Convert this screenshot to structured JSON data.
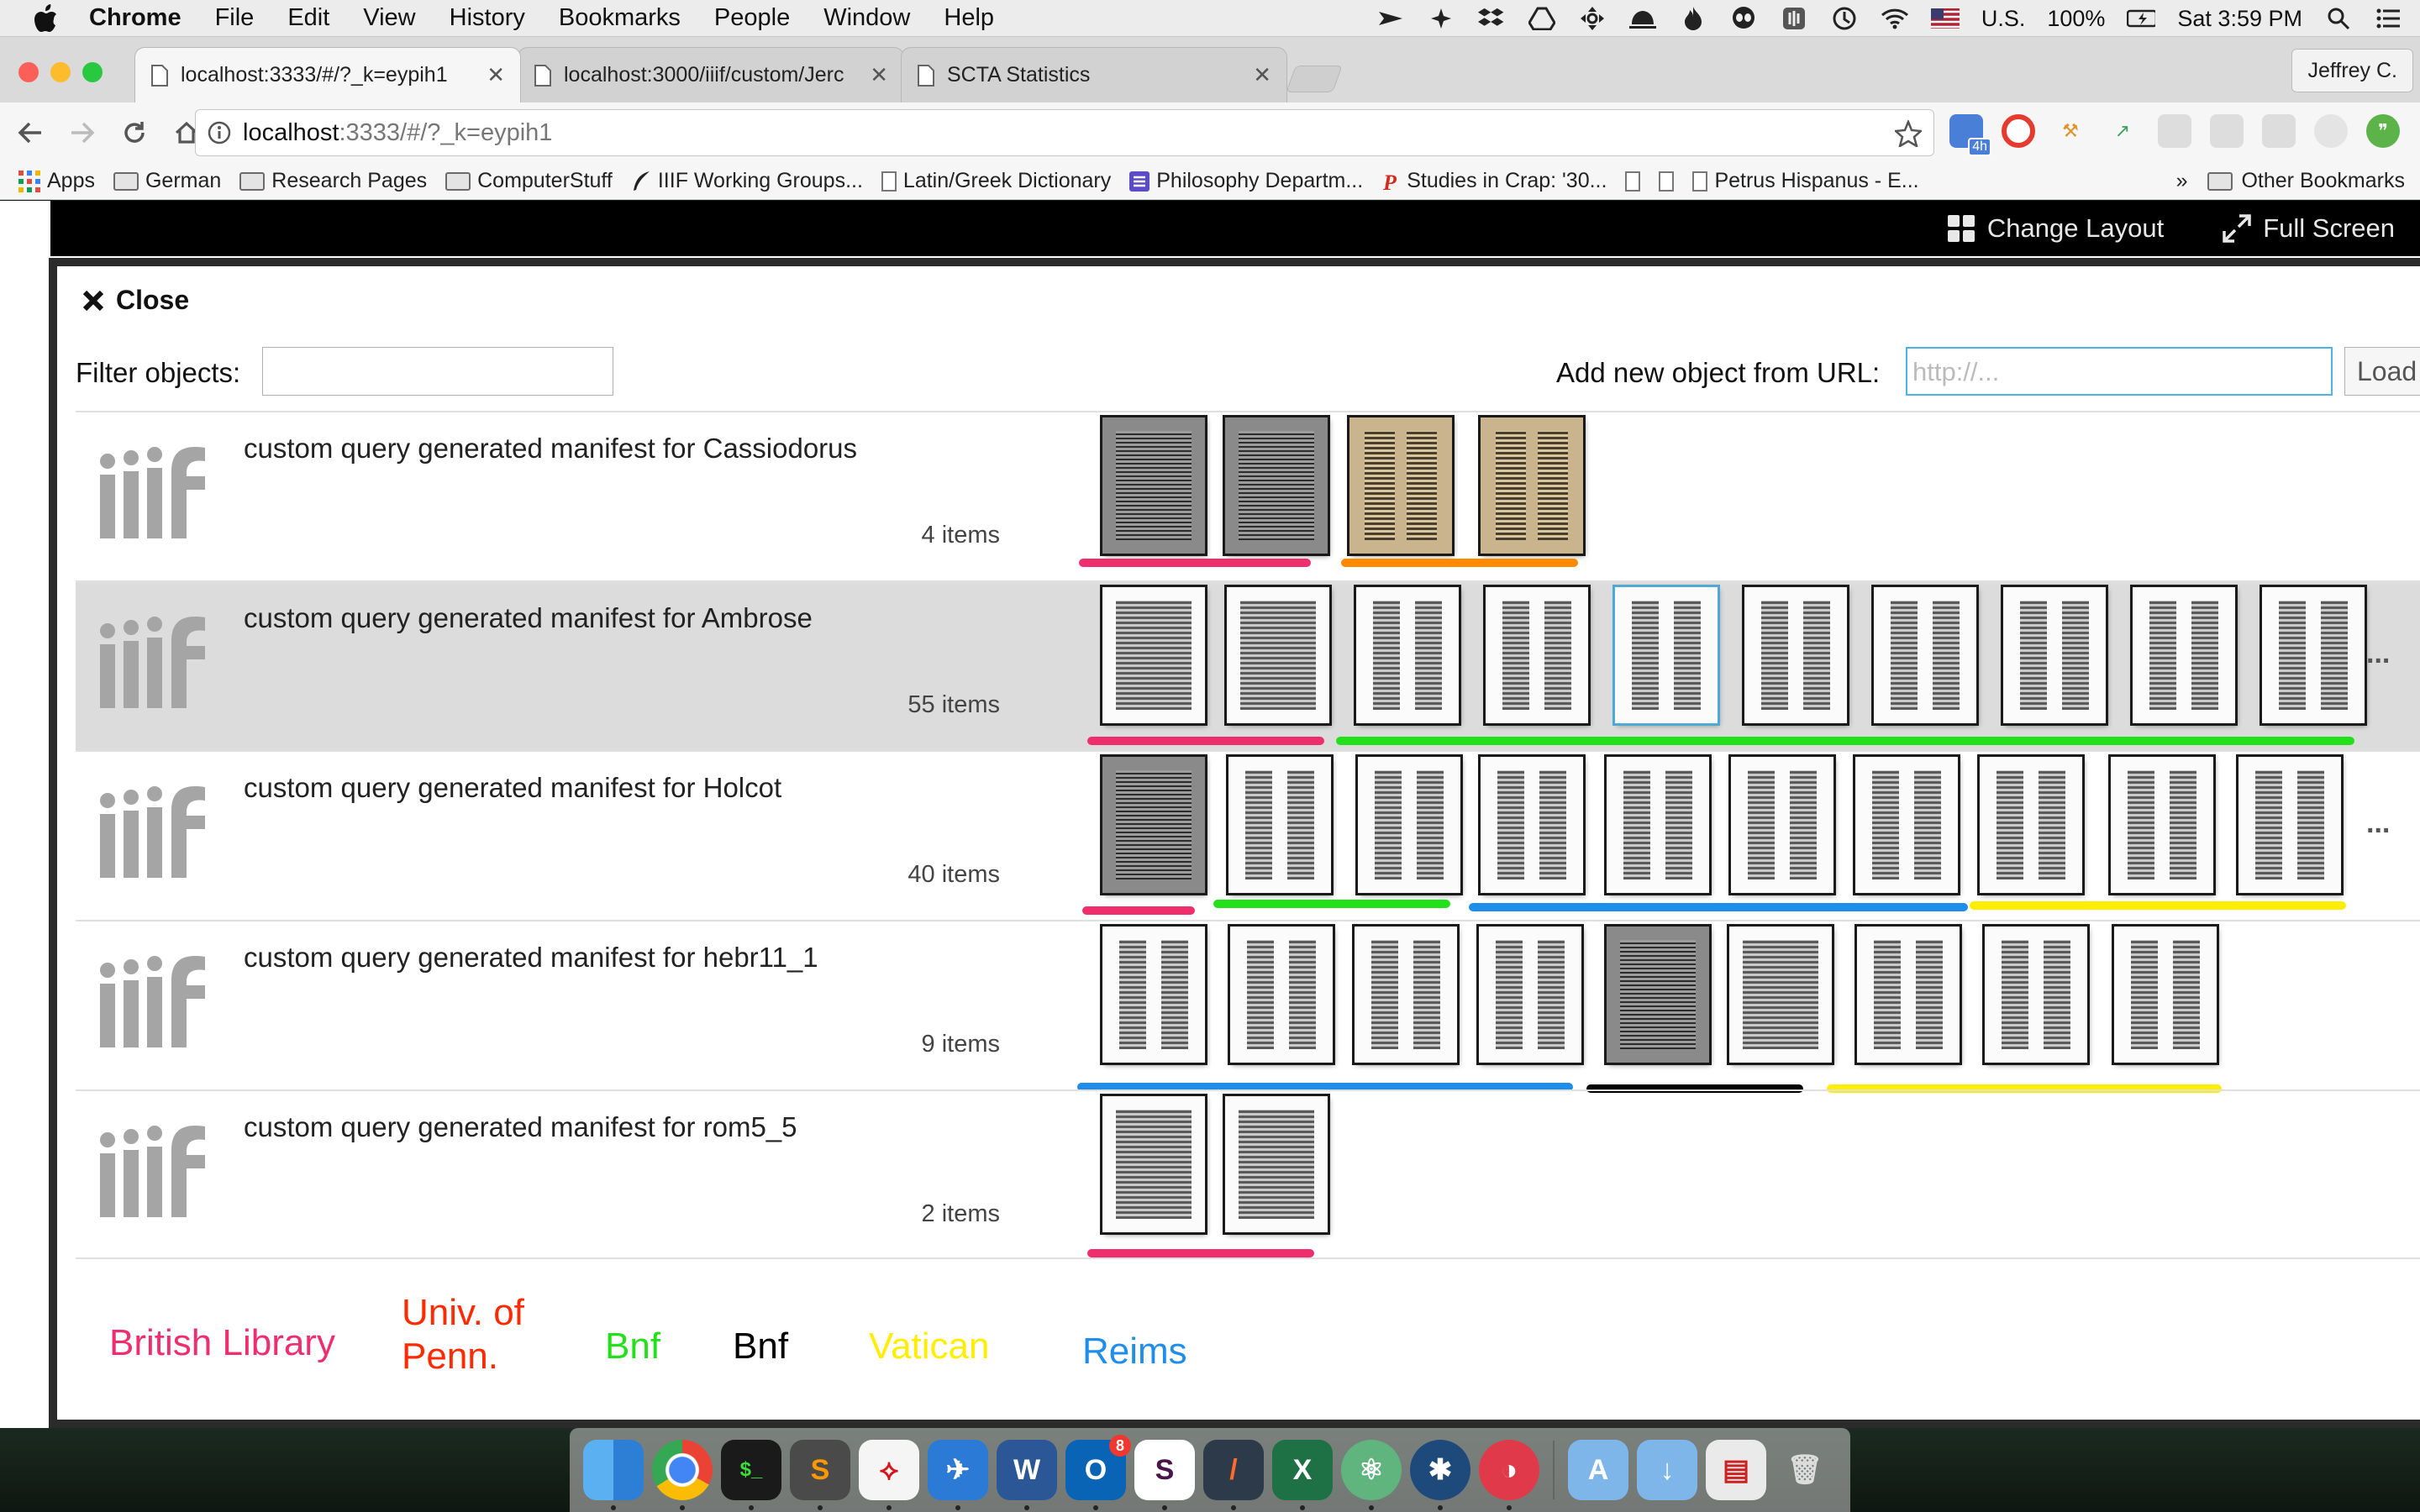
{
  "menubar": {
    "app": "Chrome",
    "items": [
      "File",
      "Edit",
      "View",
      "History",
      "Bookmarks",
      "People",
      "Window",
      "Help"
    ],
    "locale": "U.S.",
    "battery": "100%",
    "clock": "Sat 3:59 PM"
  },
  "tabs": [
    {
      "title": "localhost:3333/#/?_k=eypih1",
      "active": true
    },
    {
      "title": "localhost:3000/iiif/custom/Jerc",
      "active": false
    },
    {
      "title": "SCTA Statistics",
      "active": false
    }
  ],
  "profile": "Jeffrey C.",
  "address": {
    "host": "localhost",
    "path": ":3333/#/?_k=eypih1"
  },
  "extension_badge": "4h",
  "bookmarks": [
    "Apps",
    "German",
    "Research Pages",
    "ComputerStuff",
    "IIIF Working Groups...",
    "Latin/Greek Dictionary",
    "Philosophy Departm...",
    "Studies in Crap: '30...",
    "Petrus Hispanus - E..."
  ],
  "bookmarks_overflow": "»",
  "other_bookmarks": "Other Bookmarks",
  "appbar": {
    "change_layout": "Change Layout",
    "full_screen": "Full Screen"
  },
  "panel": {
    "close": "Close",
    "filter_label": "Filter objects:",
    "filter_value": "",
    "add_label": "Add new object from URL:",
    "url_placeholder": "http://...",
    "load": "Load"
  },
  "manifests": [
    {
      "title": "custom query generated manifest for Cassiodorus",
      "count": "4 items"
    },
    {
      "title": "custom query generated manifest for Ambrose",
      "count": "55 items"
    },
    {
      "title": "custom query generated manifest for Holcot",
      "count": "40 items"
    },
    {
      "title": "custom query generated manifest for hebr11_1",
      "count": "9 items"
    },
    {
      "title": "custom query generated manifest for rom5_5",
      "count": "2 items"
    }
  ],
  "more_glyph": "...",
  "legend": [
    {
      "label": "British Library",
      "color": "#ef2e6e"
    },
    {
      "label": "Univ. of Penn.",
      "color": "#ff2a00"
    },
    {
      "label": "Bnf",
      "color": "#22e01a"
    },
    {
      "label": "Bnf",
      "color": "#000000"
    },
    {
      "label": "Vatican",
      "color": "#ffee00"
    },
    {
      "label": "Reims",
      "color": "#1e8eea"
    }
  ],
  "dock": [
    "finder",
    "chrome",
    "terminal",
    "sublime-text",
    "acrobat",
    "tweetbot",
    "word",
    "outlook",
    "slack",
    "codekit",
    "excel",
    "atom",
    "sourcetree",
    "pocket-casts",
    "applications",
    "downloads",
    "documents",
    "trash"
  ],
  "outlook_badge": "8"
}
